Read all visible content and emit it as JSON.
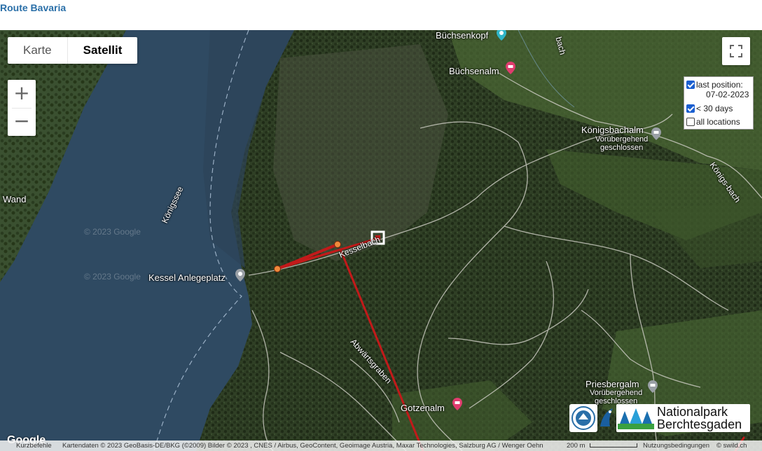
{
  "page": {
    "title": "Route Bavaria"
  },
  "map": {
    "type_control": {
      "options": [
        "Karte",
        "Satellit"
      ],
      "selected": "Satellit"
    },
    "zoom": {
      "in_label": "+",
      "out_label": "−"
    },
    "labels": {
      "buchsenkopf": "Büchsenkopf",
      "buchsenalm": "Büchsenalm",
      "konigsbachalm": "Königsbachalm",
      "konigsbachalm_status_1": "Vorübergehend",
      "konigsbachalm_status_2": "geschlossen",
      "konigsbach_top": "bach",
      "konigsbach_right": "Königs-bach",
      "wand": "Wand",
      "konigssee": "Königssee",
      "kessel_anlegeplatz": "Kessel Anlegeplatz",
      "kesselbach": "Kesselbach",
      "abwartsgraben": "Abwärtsgraben",
      "priesbergalm": "Priesbergalm",
      "priesbergalm_status_1": "Vorübergehend",
      "priesbergalm_status_2": "geschlossen",
      "gotzenalm": "Gotzenalm",
      "watermark_1": "© 2023 Google",
      "watermark_2": "© 2023 Google"
    },
    "legend": {
      "last_position_label": "last position:",
      "last_position_date": "07-02-2023",
      "last_position_checked": true,
      "days_label": "< 30 days",
      "days_checked": true,
      "all_locations_label": "all locations",
      "all_locations_checked": false
    },
    "logo": {
      "line1": "Nationalpark",
      "line2": "Berchtesgaden"
    },
    "google_logo": "Google",
    "attribution": {
      "shortcuts": "Kurzbefehle",
      "data": "Kartendaten © 2023 GeoBasis-DE/BKG (©2009) Bilder © 2023 , CNES / Airbus, GeoContent, Geoimage Austria, Maxar Technologies, Salzburg AG / Wenger Oehn",
      "scale": "200 m",
      "terms": "Nutzungsbedingungen",
      "copyright": "© swild.ch"
    },
    "colors": {
      "track": "#c21a1a",
      "water": "#2f4a62",
      "forest": "#2c3b22",
      "meadow": "#4c6a35",
      "pin_red": "#e03c6e",
      "pin_grey": "#9aa0a6"
    }
  }
}
